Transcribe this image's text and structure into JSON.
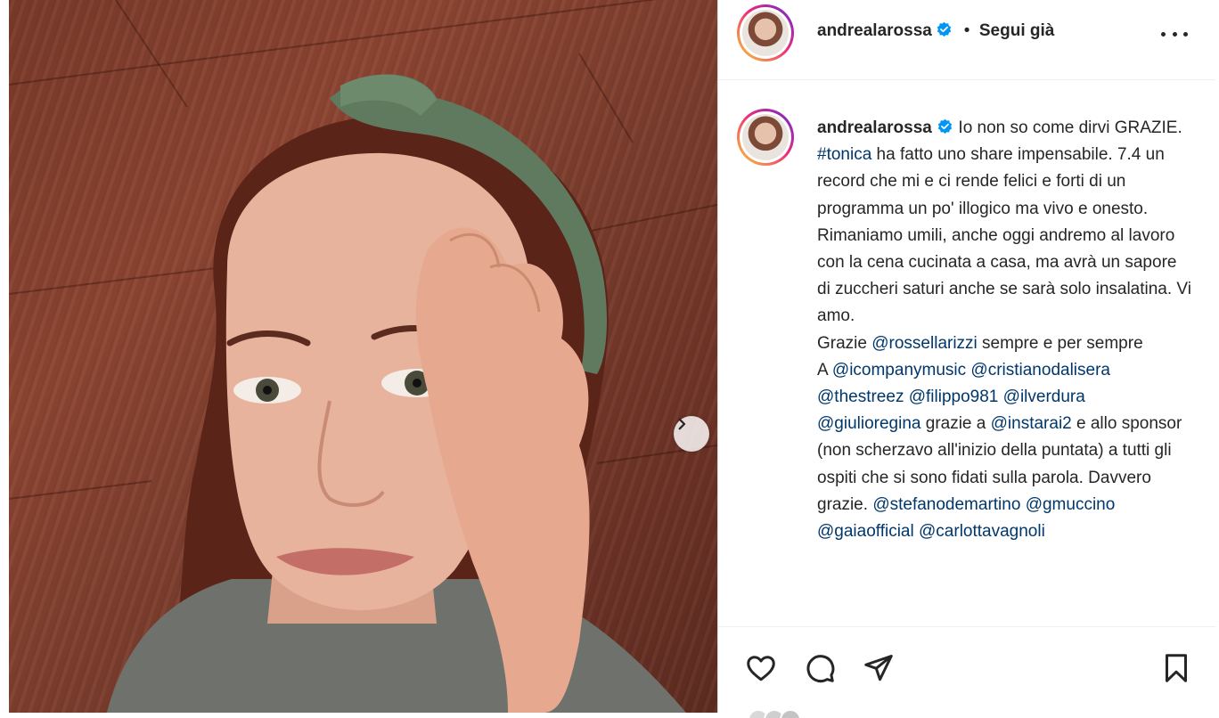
{
  "post": {
    "photo_alt": "Selfie photo",
    "next_icon": "chevron-right-icon"
  },
  "header": {
    "username": "andrealarossa",
    "verified_icon": "verified-badge-icon",
    "separator": "•",
    "follow_status": "Segui già",
    "more_icon": "more-horizontal-icon"
  },
  "caption": {
    "username": "andrealarossa",
    "line1_a": "Io non so come dirvi GRAZIE. ",
    "hashtag": "#tonica",
    "line1_b": " ha fatto uno share impensabile. 7.4 un record che mi e ci rende felici e forti di un programma un po' illogico ma vivo e onesto. Rimaniamo umili, anche oggi andremo al lavoro con la cena cucinata a casa, ma avrà un sapore di zuccheri saturi anche se sarà solo insalatina. Vi amo.",
    "grazie_a": "Grazie ",
    "mention_rossella": "@rossellarizzi",
    "grazie_b": " sempre e per sempre",
    "a_prefix": "A ",
    "mention_icompany": "@icompanymusic",
    "mention_cristiano": "@cristianodalisera",
    "mention_thestreez": "@thestreez",
    "mention_filippo": "@filippo981",
    "mention_ilverdura": "@ilverdura",
    "mention_giulio": "@giulioregina",
    "grazie_c": " grazie a ",
    "mention_instarai": "@instarai2",
    "rest": " e allo sponsor (non scherzavo all'inizio della puntata) a tutti gli ospiti che si sono fidati sulla parola. Davvero grazie.",
    "mention_stefano": "@stefanodemartino",
    "mention_gmuccino": "@gmuccino",
    "mention_gaia": "@gaiaofficial",
    "mention_carlotta": "@carlottavagnoli"
  },
  "actions": {
    "like_icon": "heart-icon",
    "comment_icon": "comment-icon",
    "share_icon": "send-icon",
    "save_icon": "bookmark-icon"
  },
  "colors": {
    "link": "#00376b",
    "verified": "#0095f6",
    "text": "#262626"
  }
}
